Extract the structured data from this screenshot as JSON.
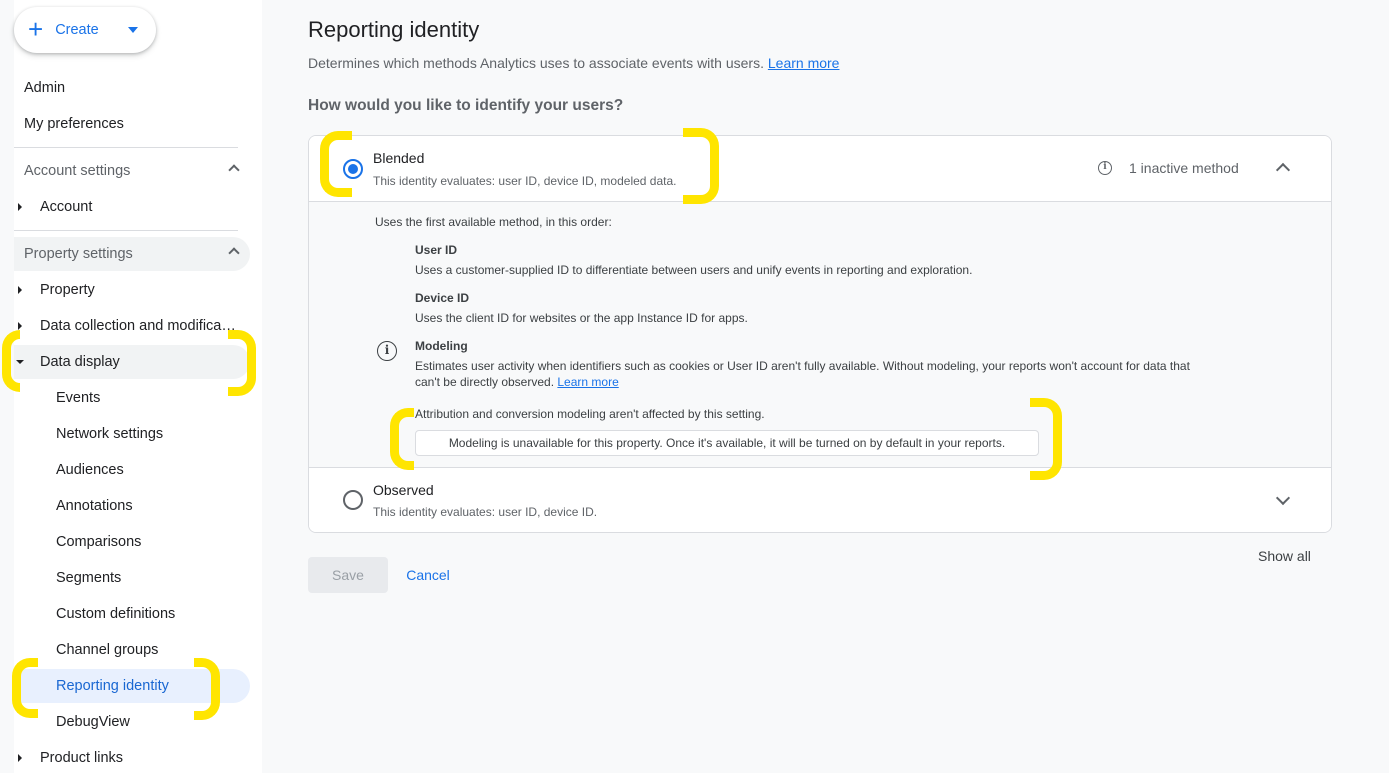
{
  "sidebar": {
    "create_label": "Create",
    "top_items": [
      "Admin",
      "My preferences"
    ],
    "account_settings": {
      "label": "Account settings",
      "items": [
        "Account"
      ]
    },
    "property_settings": {
      "label": "Property settings",
      "items": [
        "Property",
        "Data collection and modifica…",
        "Data display"
      ]
    },
    "data_display_items": [
      "Events",
      "Network settings",
      "Audiences",
      "Annotations",
      "Comparisons",
      "Segments",
      "Custom definitions",
      "Channel groups",
      "Reporting identity",
      "DebugView"
    ],
    "bottom_items": [
      "Product links"
    ],
    "active_item": "Reporting identity"
  },
  "main": {
    "title": "Reporting identity",
    "description": "Determines which methods Analytics uses to associate events with users.",
    "learn_more": "Learn more",
    "question": "How would you like to identify your users?"
  },
  "options": {
    "blended": {
      "title": "Blended",
      "subtitle": "This identity evaluates: user ID, device ID, modeled data.",
      "inactive": "1 inactive method",
      "selected": true
    },
    "observed": {
      "title": "Observed",
      "subtitle": "This identity evaluates: user ID, device ID.",
      "selected": false
    }
  },
  "expanded": {
    "intro": "Uses the first available method, in this order:",
    "user_id_title": "User ID",
    "user_id_desc": "Uses a customer-supplied ID to differentiate between users and unify events in reporting and exploration.",
    "device_id_title": "Device ID",
    "device_id_desc": "Uses the client ID for websites or the app Instance ID for apps.",
    "modeling_title": "Modeling",
    "modeling_desc_1": "Estimates user activity when identifiers such as cookies or User ID aren't fully available. Without modeling, your reports won't account for data that",
    "modeling_desc_2": "can't be directly observed.",
    "modeling_learn_more": "Learn more",
    "attribution_note": "Attribution and conversion modeling aren't affected by this setting.",
    "notice": "Modeling is unavailable for this property. Once it's available, it will be turned on by default in your reports."
  },
  "actions": {
    "save": "Save",
    "cancel": "Cancel",
    "show_all": "Show all"
  },
  "colors": {
    "accent": "#1a73e8",
    "active_bg": "#e8f0fe",
    "annotation": "#ffe500"
  }
}
